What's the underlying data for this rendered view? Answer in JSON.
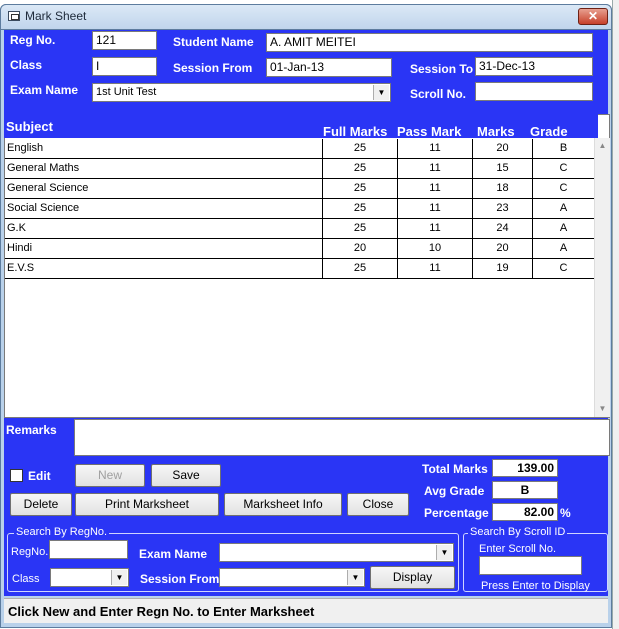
{
  "window": {
    "title": "Mark Sheet",
    "close_glyph": "✕"
  },
  "form": {
    "reg_no_label": "Reg No.",
    "reg_no_value": "121",
    "student_name_label": "Student Name",
    "student_name_value": "A. AMIT  MEITEI",
    "class_label": "Class",
    "class_value": "I",
    "session_from_label": "Session From",
    "session_from_value": "01-Jan-13",
    "session_to_label": "Session To",
    "session_to_value": "31-Dec-13",
    "exam_name_label": "Exam Name",
    "exam_name_value": "1st Unit Test",
    "scroll_no_label": "Scroll No.",
    "scroll_no_value": ""
  },
  "grid": {
    "headers": {
      "subject": "Subject",
      "full": "Full Marks",
      "pass": "Pass Mark",
      "marks": "Marks",
      "grade": "Grade"
    },
    "rows": [
      {
        "subject": "English",
        "full": "25",
        "pass": "11",
        "marks": "20",
        "grade": "B"
      },
      {
        "subject": "General Maths",
        "full": "25",
        "pass": "11",
        "marks": "15",
        "grade": "C"
      },
      {
        "subject": "General Science",
        "full": "25",
        "pass": "11",
        "marks": "18",
        "grade": "C"
      },
      {
        "subject": "Social Science",
        "full": "25",
        "pass": "11",
        "marks": "23",
        "grade": "A"
      },
      {
        "subject": "G.K",
        "full": "25",
        "pass": "11",
        "marks": "24",
        "grade": "A"
      },
      {
        "subject": "Hindi",
        "full": "20",
        "pass": "10",
        "marks": "20",
        "grade": "A"
      },
      {
        "subject": "E.V.S",
        "full": "25",
        "pass": "11",
        "marks": "19",
        "grade": "C"
      }
    ]
  },
  "remarks": {
    "label": "Remarks",
    "value": ""
  },
  "actions": {
    "edit_label": "Edit",
    "new_label": "New",
    "save_label": "Save",
    "delete_label": "Delete",
    "print_label": "Print Marksheet",
    "info_label": "Marksheet Info",
    "close_label": "Close"
  },
  "summary": {
    "total_label": "Total Marks",
    "total_value": "139.00",
    "avg_label": "Avg Grade",
    "avg_value": "B",
    "percentage_label": "Percentage",
    "percentage_value": "82.00",
    "percent_sign": "%"
  },
  "search_reg": {
    "title": "Search By RegNo.",
    "regno_label": "RegNo.",
    "exam_label": "Exam Name",
    "class_label": "Class",
    "session_label": "Session From",
    "display_label": "Display"
  },
  "search_scroll": {
    "title": "Search By Scroll ID",
    "enter_label": "Enter Scroll No.",
    "hint": "Press Enter to Display"
  },
  "status": {
    "text": "Click New and Enter Regn No. to Enter Marksheet"
  }
}
